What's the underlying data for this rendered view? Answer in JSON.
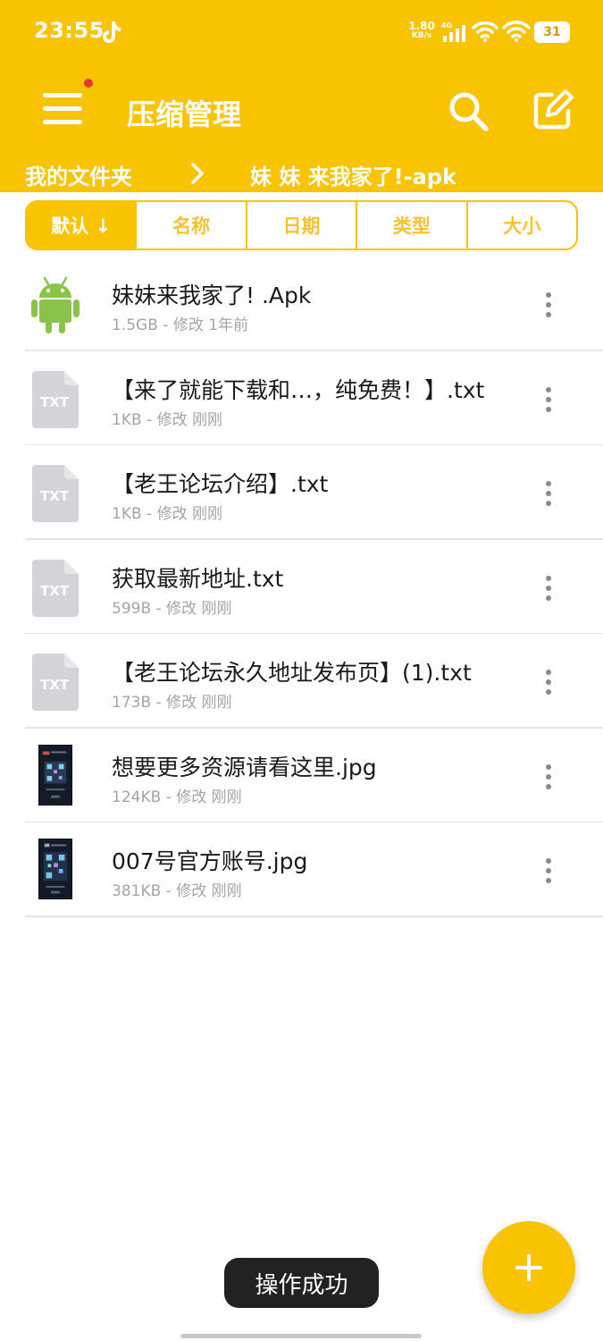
{
  "status_bar": {
    "time": "23:55",
    "net_speed_value": "1.80",
    "net_speed_unit": "KB/s",
    "network_type": "4G",
    "battery_level": "31",
    "icons": [
      "tiktok-icon",
      "signal-icon",
      "wifi-icon",
      "wifi-icon",
      "battery-icon"
    ]
  },
  "app_bar": {
    "title": "压缩管理",
    "icons": [
      "menu-icon",
      "search-icon",
      "edit-icon"
    ],
    "has_notification_dot": true
  },
  "breadcrumb": {
    "root": "我的文件夹",
    "current": "妹 妹 来我家了!-apk"
  },
  "sort_tabs": [
    {
      "label": "默认 ↓",
      "active": true
    },
    {
      "label": "名称",
      "active": false
    },
    {
      "label": "日期",
      "active": false
    },
    {
      "label": "类型",
      "active": false
    },
    {
      "label": "大小",
      "active": false
    }
  ],
  "files": [
    {
      "name": "妹妹来我家了! .Apk",
      "meta": "1.5GB - 修改 1年前",
      "type": "apk",
      "icon": "android-icon"
    },
    {
      "name": "【来了就能下载和…，纯免费！】.txt",
      "meta": "1KB - 修改 刚刚",
      "type": "txt",
      "icon_label": "TXT"
    },
    {
      "name": "【老王论坛介绍】.txt",
      "meta": "1KB - 修改 刚刚",
      "type": "txt",
      "icon_label": "TXT"
    },
    {
      "name": "获取最新地址.txt",
      "meta": "599B - 修改 刚刚",
      "type": "txt",
      "icon_label": "TXT"
    },
    {
      "name": "【老王论坛永久地址发布页】(1).txt",
      "meta": "173B - 修改 刚刚",
      "type": "txt",
      "icon_label": "TXT"
    },
    {
      "name": "想要更多资源请看这里.jpg",
      "meta": "124KB - 修改 刚刚",
      "type": "jpg",
      "icon": "image-thumbnail"
    },
    {
      "name": "007号官方账号.jpg",
      "meta": "381KB - 修改 刚刚",
      "type": "jpg",
      "icon": "image-thumbnail"
    }
  ],
  "toast": {
    "message": "操作成功"
  },
  "fab": {
    "icon": "plus-icon"
  },
  "colors": {
    "accent": "#f8c300",
    "text_primary": "#1a1a1a",
    "text_secondary": "#a4a4a4",
    "android_green": "#8bc34a",
    "txt_icon_gray": "#d3d3d8",
    "toast_bg": "#222222"
  }
}
